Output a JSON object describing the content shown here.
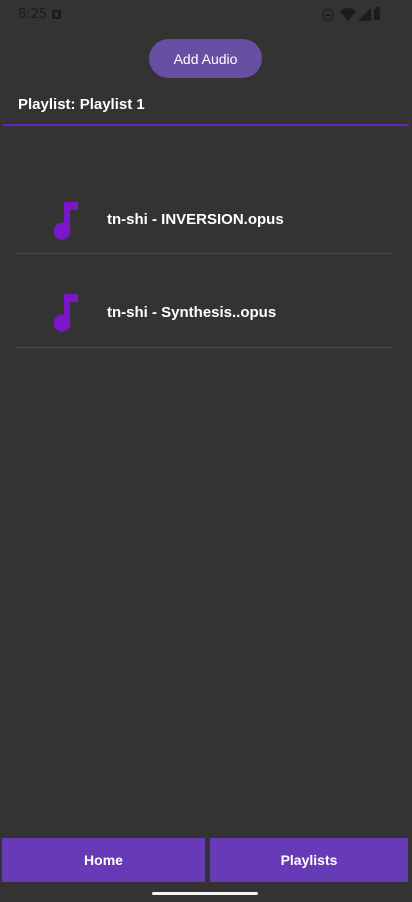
{
  "status_bar": {
    "time": "8:25"
  },
  "actions": {
    "add_audio_label": "Add Audio"
  },
  "playlist": {
    "title": "Playlist: Playlist 1",
    "tracks": [
      {
        "title": "tn-shi - INVERSION.opus"
      },
      {
        "title": "tn-shi - Synthesis..opus"
      }
    ]
  },
  "bottom_nav": {
    "home_label": "Home",
    "playlists_label": "Playlists"
  },
  "colors": {
    "background": "#333333",
    "accent_purple": "#6a1fc2",
    "button_purple": "#673ab7",
    "icon_purple": "#7a18c9"
  },
  "icons": {
    "track": "music-note-icon"
  }
}
